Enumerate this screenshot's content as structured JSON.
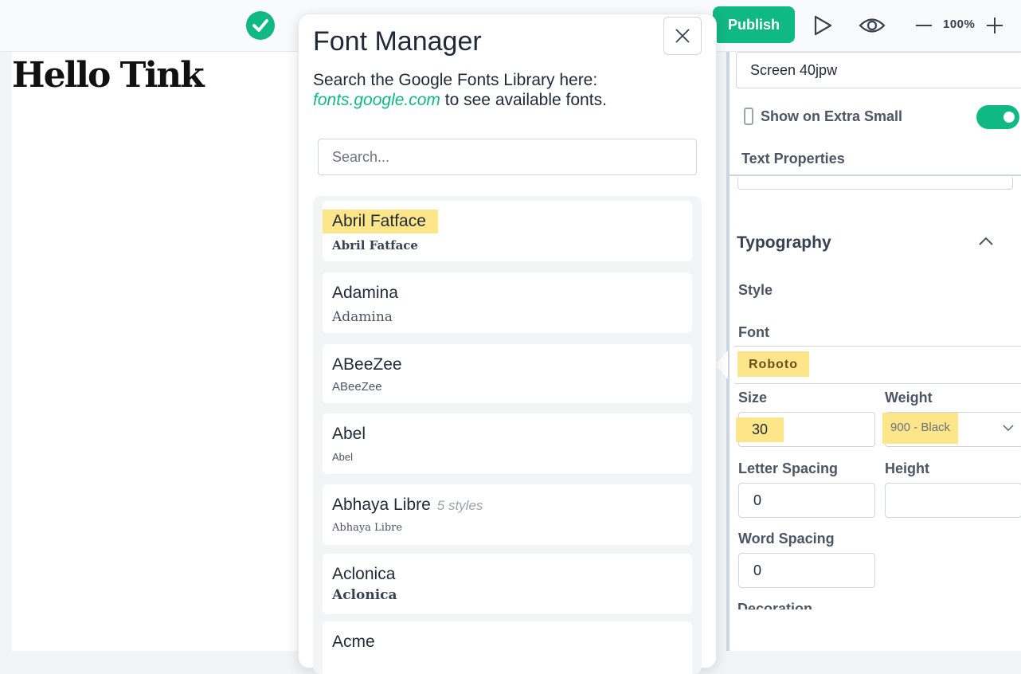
{
  "toolbar": {
    "publish_label": "Publish",
    "zoom": "100%"
  },
  "canvas": {
    "heading": "Hello Tink"
  },
  "font_manager": {
    "title": "Font Manager",
    "description_prefix": "Search the Google Fonts Library here: ",
    "link_text": "fonts.google.com",
    "description_suffix": " to see available fonts.",
    "search_placeholder": "Search...",
    "fonts": [
      {
        "name": "Abril Fatface",
        "preview": "Abril Fatface",
        "highlighted": true
      },
      {
        "name": "Adamina",
        "preview": "Adamina"
      },
      {
        "name": "ABeeZee",
        "preview": "ABeeZee"
      },
      {
        "name": "Abel",
        "preview": "Abel"
      },
      {
        "name": "Abhaya Libre",
        "styles": "5 styles",
        "preview": "Abhaya Libre"
      },
      {
        "name": "Aclonica",
        "preview": "Aclonica"
      },
      {
        "name": "Acme",
        "preview": ""
      }
    ]
  },
  "properties": {
    "screen_name": "Screen 40jpw",
    "show_label": "Show on Extra Small",
    "show_enabled": true,
    "text_properties_label": "Text Properties",
    "typography_title": "Typography",
    "style_label": "Style",
    "font_label": "Font",
    "font_value": "Roboto",
    "size_label": "Size",
    "size_value": "30",
    "weight_label": "Weight",
    "weight_value": "900 - Black",
    "letter_spacing_label": "Letter Spacing",
    "letter_spacing_value": "0",
    "height_label": "Height",
    "height_value": "",
    "word_spacing_label": "Word Spacing",
    "word_spacing_value": "0",
    "decoration_label": "Decoration"
  },
  "colors": {
    "accent": "#10b981",
    "highlight": "#fde68a"
  }
}
